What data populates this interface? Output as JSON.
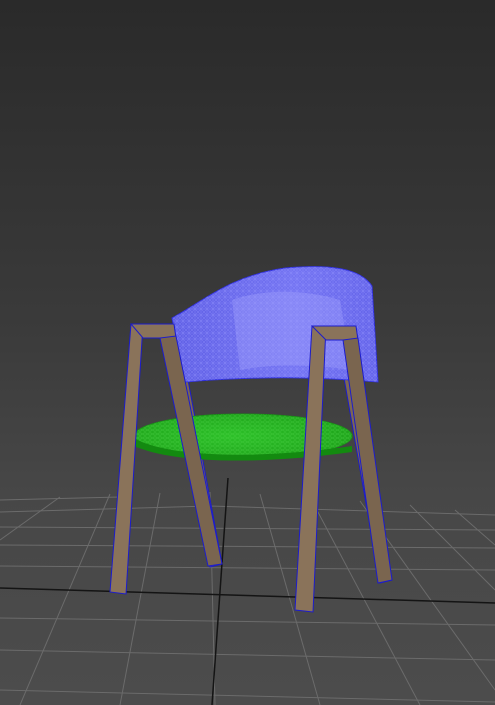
{
  "viewport": {
    "name": "3d-perspective-viewport",
    "background_top": "#2a2a2a",
    "background_bottom": "#4c4c4c"
  },
  "scene": {
    "object": "chair",
    "display_mode": "wireframe-over-shaded",
    "grid": {
      "visible": true,
      "color": "#6a6a6a",
      "axis_color": "#151515"
    },
    "colors": {
      "backrest": "#6b6bf0",
      "backrest_wire": "#8c8cff",
      "seat": "#22b11e",
      "seat_wire": "#4fd84a",
      "legs": "#8a735a",
      "legs_dark": "#6e5b47",
      "outline": "#1c1ccc"
    }
  }
}
